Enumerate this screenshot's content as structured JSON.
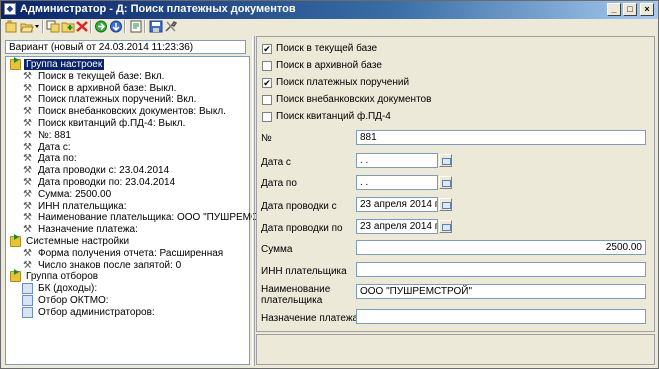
{
  "window": {
    "title": "Администратор - Д: Поиск платежных документов"
  },
  "variant": {
    "text": "Вариант (новый от 24.03.2014 11:23:36)"
  },
  "tree": {
    "group_settings": "Группа настроек",
    "items": [
      "Поиск в текущей базе:  Вкл.",
      "Поиск в архивной базе:  Выкл.",
      "Поиск платежных поручений:  Вкл.",
      "Поиск внебанковских документов:  Выкл.",
      "Поиск квитанций ф.ПД-4:  Выкл.",
      "№:  881",
      "Дата с:",
      "Дата по:",
      "Дата проводки с:  23.04.2014",
      "Дата проводки по:  23.04.2014",
      "Сумма:  2500.00",
      "ИНН плательщика:",
      "Наименование плательщика:  ООО \"ПУШРЕМСТРОЙ\"",
      "Назначение платежа:"
    ],
    "system_settings": "Системные настройки",
    "system_items": [
      "Форма получения отчета:  Расширенная",
      "Число знаков после запятой:  0"
    ],
    "filter_group": "Группа отборов",
    "filter_items": [
      "БК (доходы):",
      "Отбор ОКТМО:",
      "Отбор администраторов:"
    ]
  },
  "checkboxes": [
    {
      "label": "Поиск в текущей базе",
      "checked": true
    },
    {
      "label": "Поиск в архивной базе",
      "checked": false
    },
    {
      "label": "Поиск платежных поручений",
      "checked": true
    },
    {
      "label": "Поиск внебанковских документов",
      "checked": false
    },
    {
      "label": "Поиск квитанций ф.ПД-4",
      "checked": false
    }
  ],
  "form": {
    "number": {
      "label": "№",
      "value": "881"
    },
    "date_from": {
      "label": "Дата с",
      "value": " . ."
    },
    "date_to": {
      "label": "Дата по",
      "value": " . ."
    },
    "post_from": {
      "label": "Дата проводки с",
      "value": "23 апреля 2014 г."
    },
    "post_to": {
      "label": "Дата проводки по",
      "value": "23 апреля 2014 г."
    },
    "amount": {
      "label": "Сумма",
      "value": "2500.00"
    },
    "inn": {
      "label": "ИНН плательщика",
      "value": ""
    },
    "payer_name": {
      "label_line1": "Наименование",
      "label_line2": "плательщика",
      "value": "ООО \"ПУШРЕМСТРОЙ\""
    },
    "purpose": {
      "label": "Назначение платежа",
      "value": ""
    }
  },
  "colors": {
    "title_bar": "#0A246A",
    "selection": "#0A246A",
    "panel_bg": "#ECE9D8"
  }
}
